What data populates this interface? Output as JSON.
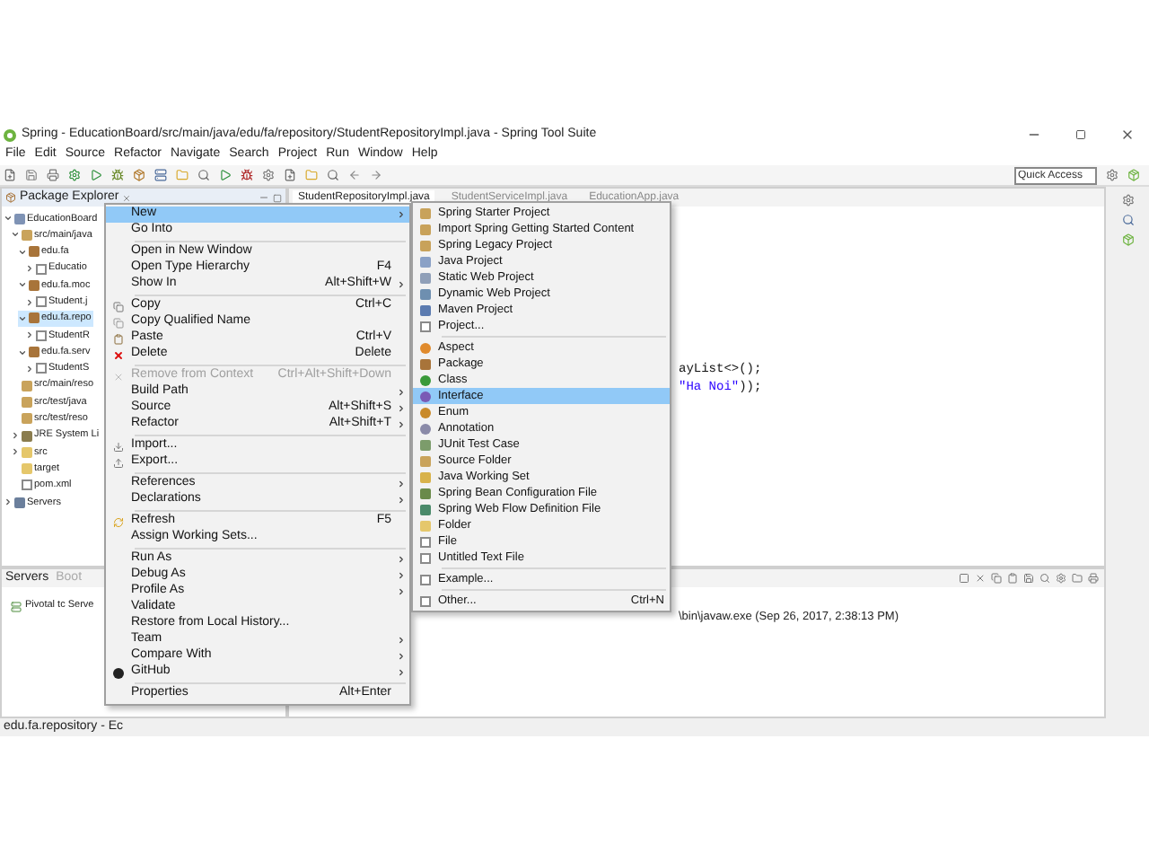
{
  "window": {
    "title": "Spring - EducationBoard/src/main/java/edu/fa/repository/StudentRepositoryImpl.java - Spring Tool Suite"
  },
  "menu_bar": [
    "File",
    "Edit",
    "Source",
    "Refactor",
    "Navigate",
    "Search",
    "Project",
    "Run",
    "Window",
    "Help"
  ],
  "quick_access": {
    "placeholder": "Quick Access"
  },
  "explorer": {
    "title": "Package Explorer",
    "tree": [
      {
        "label": "EducationBoard",
        "kind": "project",
        "expanded": true,
        "selected": false,
        "children": [
          {
            "label": "src/main/java",
            "kind": "source-folder",
            "expanded": true,
            "selected": false,
            "children": [
              {
                "label": "edu.fa",
                "kind": "package",
                "expanded": true,
                "selected": false,
                "children": [
                  {
                    "label": "Educatio",
                    "kind": "java-file",
                    "expanded": false,
                    "selected": false
                  }
                ]
              },
              {
                "label": "edu.fa.moc",
                "kind": "package",
                "expanded": true,
                "selected": false,
                "children": [
                  {
                    "label": "Student.j",
                    "kind": "java-file",
                    "expanded": false,
                    "selected": false
                  }
                ]
              },
              {
                "label": "edu.fa.repo",
                "kind": "package",
                "expanded": true,
                "selected": true,
                "children": [
                  {
                    "label": "StudentR",
                    "kind": "java-file",
                    "expanded": false,
                    "selected": false
                  }
                ]
              },
              {
                "label": "edu.fa.serv",
                "kind": "package",
                "expanded": true,
                "selected": false,
                "children": [
                  {
                    "label": "StudentS",
                    "kind": "java-file",
                    "expanded": false,
                    "selected": false
                  }
                ]
              }
            ]
          },
          {
            "label": "src/main/reso",
            "kind": "source-folder",
            "selected": false
          },
          {
            "label": "src/test/java",
            "kind": "source-folder",
            "selected": false
          },
          {
            "label": "src/test/reso",
            "kind": "source-folder",
            "selected": false
          },
          {
            "label": "JRE System Li",
            "kind": "library",
            "expanded": false,
            "selected": false
          },
          {
            "label": "src",
            "kind": "folder",
            "expanded": false,
            "selected": false
          },
          {
            "label": "target",
            "kind": "folder",
            "selected": false
          },
          {
            "label": "pom.xml",
            "kind": "file",
            "selected": false
          }
        ]
      },
      {
        "label": "Servers",
        "kind": "servers",
        "expanded": false,
        "selected": false
      }
    ]
  },
  "editor": {
    "tabs": [
      {
        "label": "StudentRepositoryImpl.java",
        "selected": true
      },
      {
        "label": "StudentServiceImpl.java",
        "selected": false
      },
      {
        "label": "EducationApp.java",
        "selected": false
      }
    ],
    "code_lines": [
      [
        {
          "text": "ayList<>();",
          "kind": "plain"
        }
      ],
      [
        {
          "text": "\"Ha Noi\"",
          "kind": "string"
        },
        {
          "text": "));",
          "kind": "plain"
        }
      ]
    ]
  },
  "servers_panel": {
    "tabs": [
      {
        "label": "Servers",
        "selected": true
      },
      {
        "label": "Boot",
        "selected": false
      }
    ],
    "rows": [
      "Pivotal tc Serve"
    ]
  },
  "console": {
    "title": "\\bin\\javaw.exe (Sep 26, 2017, 2:38:13 PM)"
  },
  "status_bar": "edu.fa.repository - Ec",
  "context_menu": [
    {
      "kind": "item",
      "label": "New",
      "submenu": true,
      "selected": true,
      "disabled": false
    },
    {
      "kind": "item",
      "label": "Go Into",
      "submenu": false,
      "selected": false,
      "disabled": false
    },
    {
      "kind": "separator"
    },
    {
      "kind": "item",
      "label": "Open in New Window",
      "submenu": false,
      "selected": false,
      "disabled": false
    },
    {
      "kind": "item",
      "label": "Open Type Hierarchy",
      "shortcut": "F4",
      "submenu": false,
      "selected": false,
      "disabled": false
    },
    {
      "kind": "item",
      "label": "Show In",
      "shortcut": "Alt+Shift+W",
      "submenu": true,
      "selected": false,
      "disabled": false
    },
    {
      "kind": "separator"
    },
    {
      "kind": "item",
      "label": "Copy",
      "shortcut": "Ctrl+C",
      "submenu": false,
      "selected": false,
      "disabled": false
    },
    {
      "kind": "item",
      "label": "Copy Qualified Name",
      "submenu": false,
      "selected": false,
      "disabled": false
    },
    {
      "kind": "item",
      "label": "Paste",
      "shortcut": "Ctrl+V",
      "submenu": false,
      "selected": false,
      "disabled": false
    },
    {
      "kind": "item",
      "label": "Delete",
      "shortcut": "Delete",
      "submenu": false,
      "selected": false,
      "disabled": false
    },
    {
      "kind": "separator"
    },
    {
      "kind": "item",
      "label": "Remove from Context",
      "shortcut": "Ctrl+Alt+Shift+Down",
      "submenu": false,
      "selected": false,
      "disabled": true
    },
    {
      "kind": "item",
      "label": "Build Path",
      "submenu": true,
      "selected": false,
      "disabled": false
    },
    {
      "kind": "item",
      "label": "Source",
      "shortcut": "Alt+Shift+S",
      "submenu": true,
      "selected": false,
      "disabled": false
    },
    {
      "kind": "item",
      "label": "Refactor",
      "shortcut": "Alt+Shift+T",
      "submenu": true,
      "selected": false,
      "disabled": false
    },
    {
      "kind": "separator"
    },
    {
      "kind": "item",
      "label": "Import...",
      "submenu": false,
      "selected": false,
      "disabled": false
    },
    {
      "kind": "item",
      "label": "Export...",
      "submenu": false,
      "selected": false,
      "disabled": false
    },
    {
      "kind": "separator"
    },
    {
      "kind": "item",
      "label": "References",
      "submenu": true,
      "selected": false,
      "disabled": false
    },
    {
      "kind": "item",
      "label": "Declarations",
      "submenu": true,
      "selected": false,
      "disabled": false
    },
    {
      "kind": "separator"
    },
    {
      "kind": "item",
      "label": "Refresh",
      "shortcut": "F5",
      "submenu": false,
      "selected": false,
      "disabled": false
    },
    {
      "kind": "item",
      "label": "Assign Working Sets...",
      "submenu": false,
      "selected": false,
      "disabled": false
    },
    {
      "kind": "separator"
    },
    {
      "kind": "item",
      "label": "Run As",
      "submenu": true,
      "selected": false,
      "disabled": false
    },
    {
      "kind": "item",
      "label": "Debug As",
      "submenu": true,
      "selected": false,
      "disabled": false
    },
    {
      "kind": "item",
      "label": "Profile As",
      "submenu": true,
      "selected": false,
      "disabled": false
    },
    {
      "kind": "item",
      "label": "Validate",
      "submenu": false,
      "selected": false,
      "disabled": false
    },
    {
      "kind": "item",
      "label": "Restore from Local History...",
      "submenu": false,
      "selected": false,
      "disabled": false
    },
    {
      "kind": "item",
      "label": "Team",
      "submenu": true,
      "selected": false,
      "disabled": false
    },
    {
      "kind": "item",
      "label": "Compare With",
      "submenu": true,
      "selected": false,
      "disabled": false
    },
    {
      "kind": "item",
      "label": "GitHub",
      "submenu": true,
      "selected": false,
      "disabled": false
    },
    {
      "kind": "separator"
    },
    {
      "kind": "item",
      "label": "Properties",
      "shortcut": "Alt+Enter",
      "submenu": false,
      "selected": false,
      "disabled": false
    }
  ],
  "new_submenu": [
    {
      "kind": "item",
      "label": "Spring Starter Project",
      "selected": false
    },
    {
      "kind": "item",
      "label": "Import Spring Getting Started Content",
      "selected": false
    },
    {
      "kind": "item",
      "label": "Spring Legacy Project",
      "selected": false
    },
    {
      "kind": "item",
      "label": "Java Project",
      "selected": false
    },
    {
      "kind": "item",
      "label": "Static Web Project",
      "selected": false
    },
    {
      "kind": "item",
      "label": "Dynamic Web Project",
      "selected": false
    },
    {
      "kind": "item",
      "label": "Maven Project",
      "selected": false
    },
    {
      "kind": "item",
      "label": "Project...",
      "selected": false
    },
    {
      "kind": "separator"
    },
    {
      "kind": "item",
      "label": "Aspect",
      "selected": false
    },
    {
      "kind": "item",
      "label": "Package",
      "selected": false
    },
    {
      "kind": "item",
      "label": "Class",
      "selected": false
    },
    {
      "kind": "item",
      "label": "Interface",
      "selected": true
    },
    {
      "kind": "item",
      "label": "Enum",
      "selected": false
    },
    {
      "kind": "item",
      "label": "Annotation",
      "selected": false
    },
    {
      "kind": "item",
      "label": "JUnit Test Case",
      "selected": false
    },
    {
      "kind": "item",
      "label": "Source Folder",
      "selected": false
    },
    {
      "kind": "item",
      "label": "Java Working Set",
      "selected": false
    },
    {
      "kind": "item",
      "label": "Spring Bean Configuration File",
      "selected": false
    },
    {
      "kind": "item",
      "label": "Spring Web Flow Definition File",
      "selected": false
    },
    {
      "kind": "item",
      "label": "Folder",
      "selected": false
    },
    {
      "kind": "item",
      "label": "File",
      "selected": false
    },
    {
      "kind": "item",
      "label": "Untitled Text File",
      "selected": false
    },
    {
      "kind": "separator"
    },
    {
      "kind": "item",
      "label": "Example...",
      "selected": false
    },
    {
      "kind": "separator"
    },
    {
      "kind": "item",
      "label": "Other...",
      "shortcut": "Ctrl+N",
      "selected": false
    }
  ]
}
